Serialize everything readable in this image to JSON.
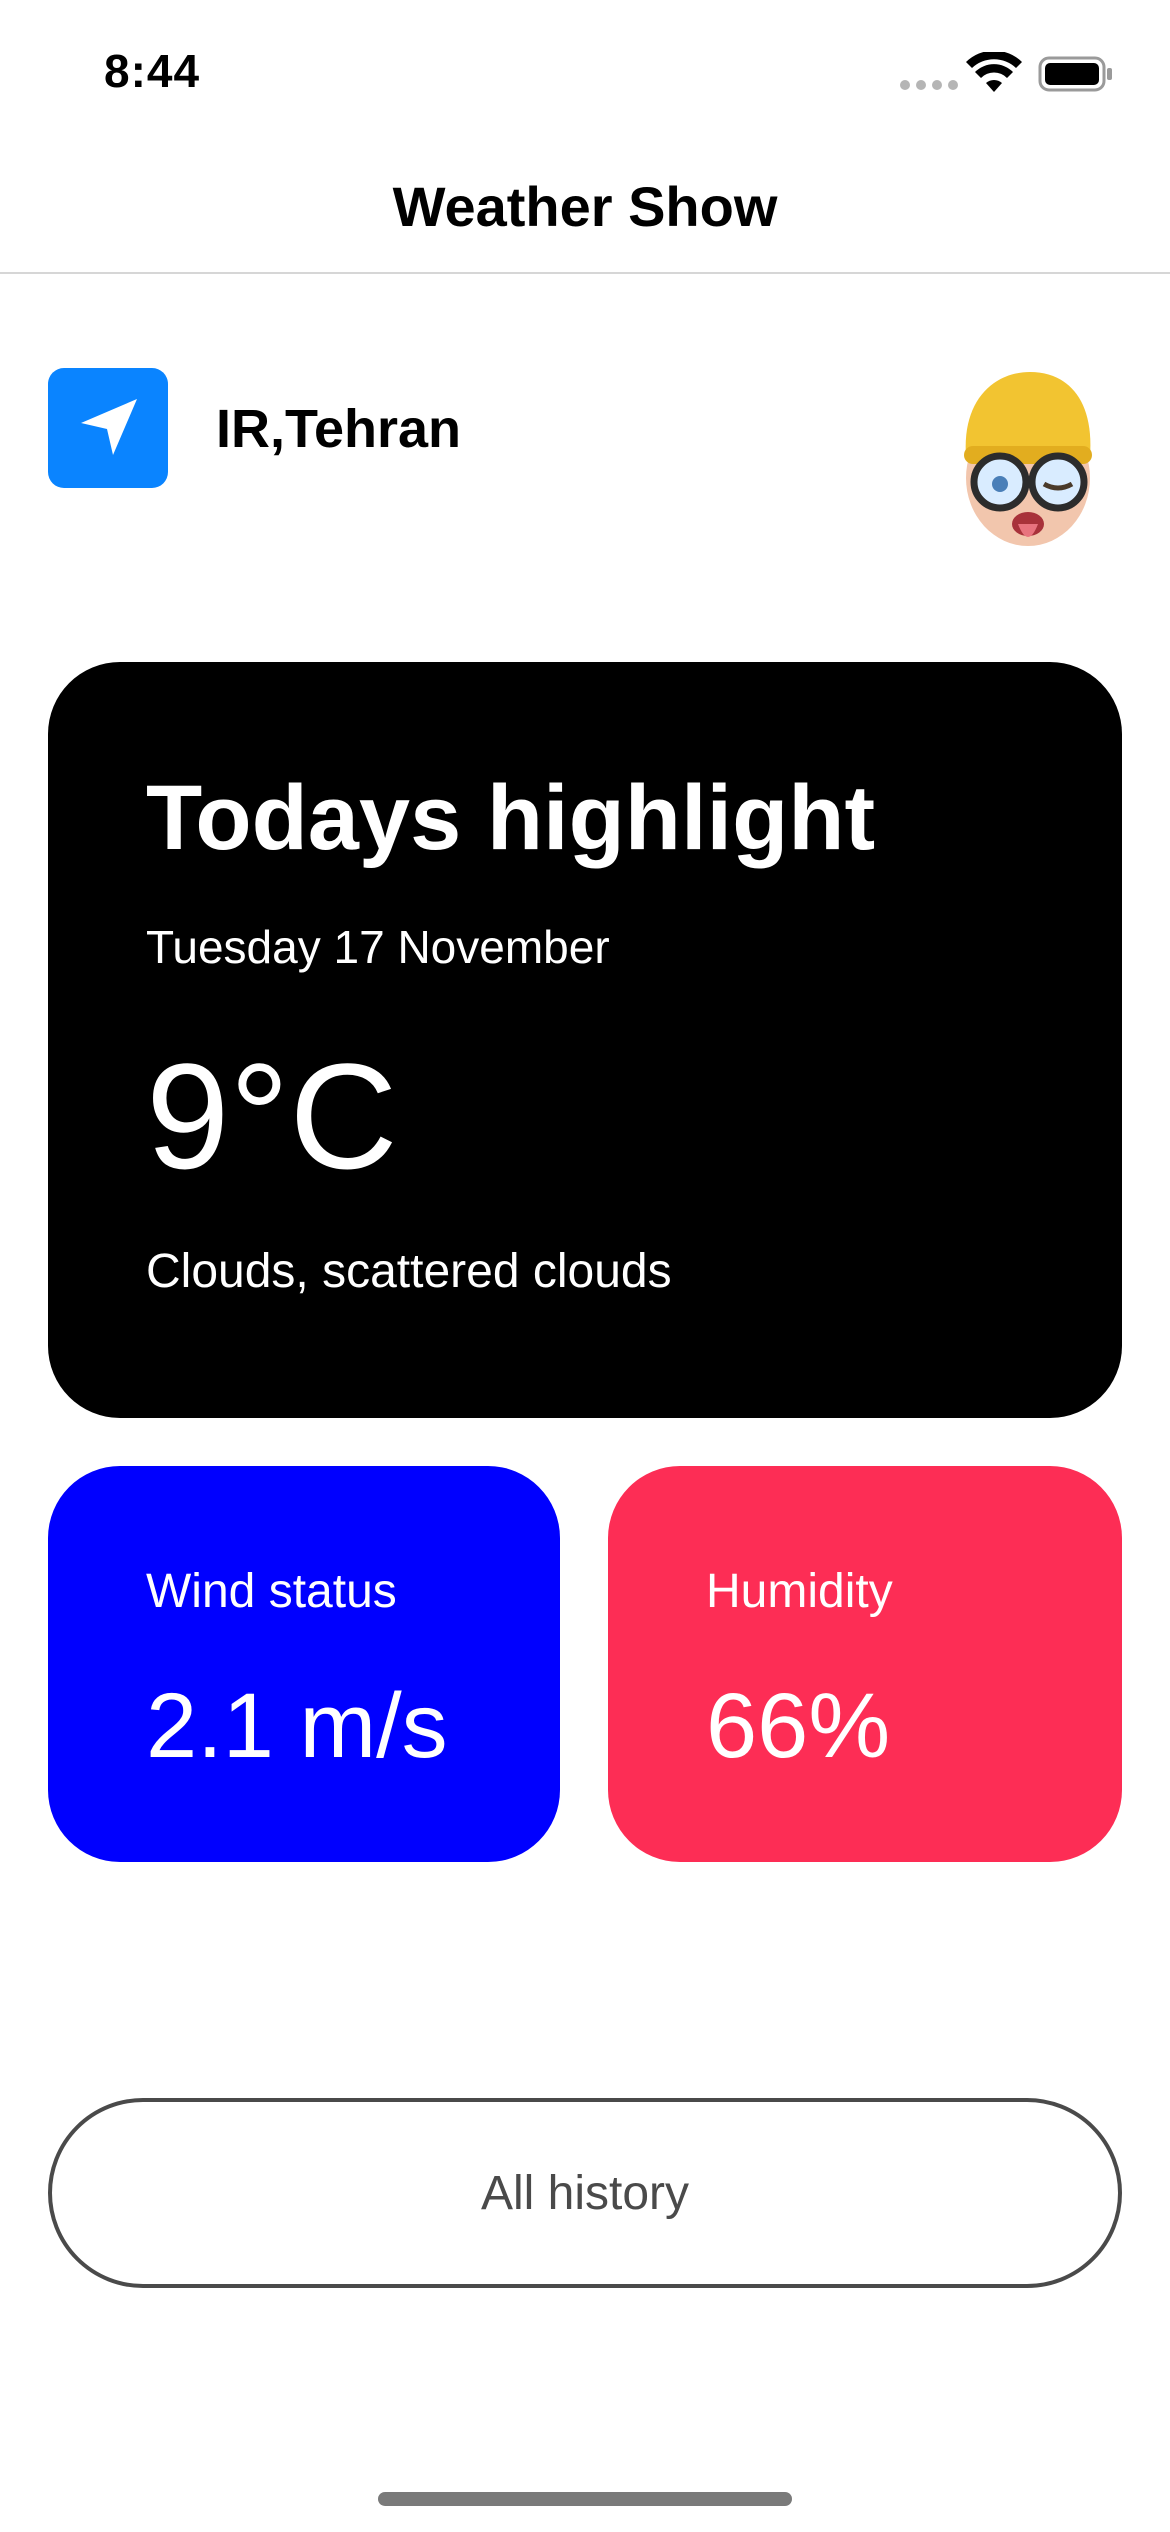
{
  "status_bar": {
    "time": "8:44"
  },
  "nav": {
    "title": "Weather Show"
  },
  "location": {
    "label": "IR,Tehran",
    "icon": "location-arrow-icon",
    "accent_color": "#0a84ff"
  },
  "highlight": {
    "title": "Todays highlight",
    "date": "Tuesday 17 November",
    "temperature": "9°C",
    "description": "Clouds, scattered clouds",
    "background_color": "#000000"
  },
  "wind": {
    "label": "Wind status",
    "value": "2.1 m/s",
    "background_color": "#0000ff"
  },
  "humidity": {
    "label": "Humidity",
    "value": "66%",
    "background_color": "#fd2d55"
  },
  "history_button": {
    "label": "All history"
  }
}
